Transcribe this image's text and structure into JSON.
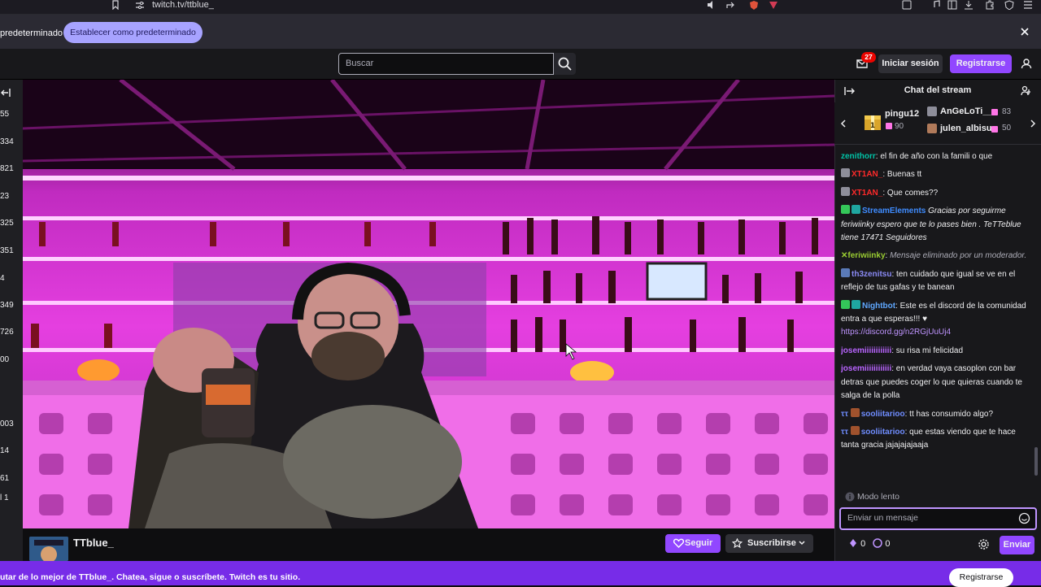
{
  "browser": {
    "url": "twitch.tv/ttblue_",
    "default_prompt": "predeterminado",
    "set_default_label": "Establecer como predeterminado"
  },
  "topnav": {
    "search_placeholder": "Buscar",
    "notification_count": "27",
    "login_label": "Iniciar sesión",
    "register_label": "Registrarse"
  },
  "sidebar": {
    "counts": [
      "55",
      "334",
      "821",
      "23",
      "325",
      "351",
      "4",
      "349",
      "726",
      "00",
      "003",
      "14",
      "61",
      "l 1"
    ]
  },
  "channel": {
    "name": "TTblue_",
    "follow_label": "Seguir",
    "subscribe_label": "Suscribirse"
  },
  "chat": {
    "title": "Chat del stream",
    "gifters": [
      {
        "name": "pingu12",
        "count": "90"
      },
      {
        "name": "AnGeLoTi__",
        "count": "83"
      },
      {
        "name": "julen_albisu",
        "count": "50"
      }
    ],
    "messages": [
      {
        "user": "zenithorr",
        "color": "#00c4a7",
        "text": ": el fin de año con la famili o que"
      },
      {
        "user": "XT1AN_",
        "color": "#ff2a2a",
        "text": ": Buenas tt"
      },
      {
        "user": "XT1AN_",
        "color": "#ff2a2a",
        "text": ": Que comes??"
      },
      {
        "user": "StreamElements",
        "color": "#3f8cff",
        "text": "Gracias por seguirme feriwiinky espero que te lo pases bien . TeTTeblue tiene 17471 Seguidores"
      },
      {
        "user": "feriwiinky",
        "color": "#9acd32",
        "text": "Mensaje eliminado por un moderador."
      },
      {
        "user": "th3zenitsu",
        "color": "#8a8af5",
        "text": ": ten cuidado que igual se ve en el reflejo de tus gafas y te banean"
      },
      {
        "user": "Nightbot",
        "color": "#5fa8ff",
        "text": ": Este es el discord de la comunidad entra a que esperas!!! ♥",
        "link": "https://discord.gg/n2RGjUuUj4"
      },
      {
        "user": "josemiiiiiiiiiiii",
        "color": "#b964ff",
        "text": ": su risa mi felicidad"
      },
      {
        "user": "josemiiiiiiiiiiii",
        "color": "#b964ff",
        "text": ": en verdad vaya casoplon con bar detras que puedes coger lo que quieras cuando te salga de la polla"
      },
      {
        "user": "sooliitarioo",
        "color": "#6f8dff",
        "text": ": tt has consumido algo?"
      },
      {
        "user": "sooliitarioo",
        "color": "#6f8dff",
        "text": ": que estas viendo que te hace tanta gracia jajajajajaaja"
      }
    ],
    "slow_mode": "Modo lento",
    "input_placeholder": "Enviar un mensaje",
    "points_a": "0",
    "points_b": "0",
    "send_label": "Enviar"
  },
  "banner": {
    "text": "utar de lo mejor de TTblue_. Chatea, sigue o suscríbete. Twitch es tu sitio.",
    "register_label": "Registrarse"
  }
}
